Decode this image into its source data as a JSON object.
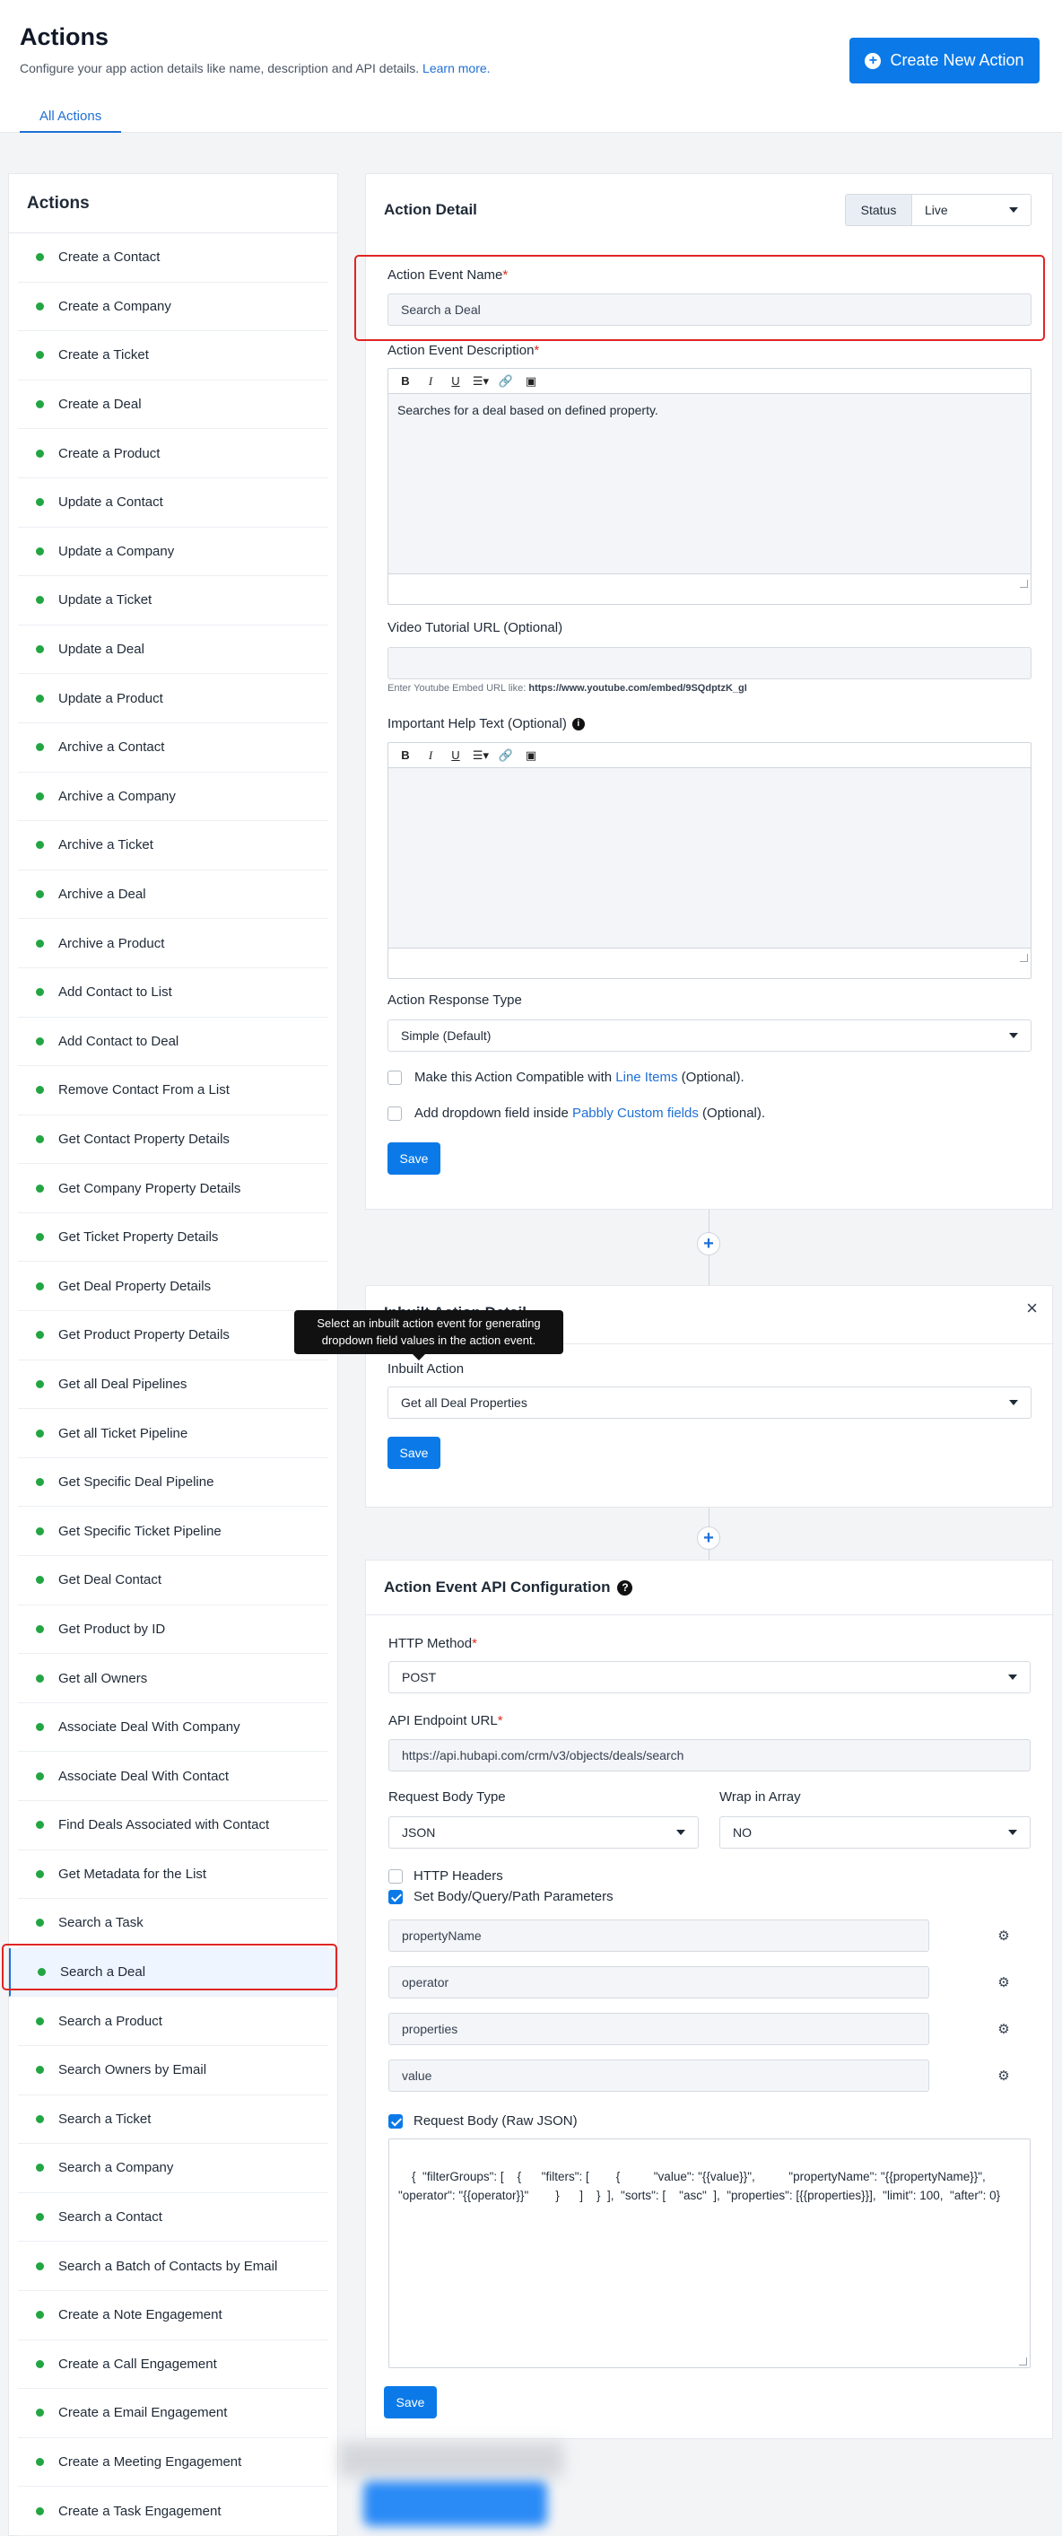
{
  "header": {
    "title": "Actions",
    "subtitle": "Configure your app action details like name, description and API details.",
    "learn_more": "Learn more.",
    "create_button": "Create New Action",
    "tab_all": "All Actions"
  },
  "sidebar": {
    "title": "Actions",
    "items": [
      "Create a Contact",
      "Create a Company",
      "Create a Ticket",
      "Create a Deal",
      "Create a Product",
      "Update a Contact",
      "Update a Company",
      "Update a Ticket",
      "Update a Deal",
      "Update a Product",
      "Archive a Contact",
      "Archive a Company",
      "Archive a Ticket",
      "Archive a Deal",
      "Archive a Product",
      "Add Contact to List",
      "Add Contact to Deal",
      "Remove Contact From a List",
      "Get Contact Property Details",
      "Get Company Property Details",
      "Get Ticket Property Details",
      "Get Deal Property Details",
      "Get Product Property Details",
      "Get all Deal Pipelines",
      "Get all Ticket Pipeline",
      "Get Specific Deal Pipeline",
      "Get Specific Ticket Pipeline",
      "Get Deal Contact",
      "Get Product by ID",
      "Get all Owners",
      "Associate Deal With Company",
      "Associate Deal With Contact",
      "Find Deals Associated with Contact",
      "Get Metadata for the List",
      "Search a Task",
      "Search a Deal",
      "Search a Product",
      "Search Owners by Email",
      "Search a Ticket",
      "Search a Company",
      "Search a Contact",
      "Search a Batch of Contacts by Email",
      "Create a Note Engagement",
      "Create a Call Engagement",
      "Create a Email Engagement",
      "Create a Meeting Engagement",
      "Create a Task Engagement"
    ],
    "active_index": 35
  },
  "action_detail": {
    "title": "Action Detail",
    "status_label": "Status",
    "status_value": "Live",
    "name_label": "Action Event Name",
    "required_mark": "*",
    "name_value": "Search a Deal",
    "desc_label": "Action Event Description",
    "desc_value": "Searches for a deal based on defined property.",
    "video_label": "Video Tutorial URL (Optional)",
    "video_hint_prefix": "Enter Youtube Embed URL like: ",
    "video_hint_url": "https://www.youtube.com/embed/9SQdptzK_gI",
    "help_label": "Important Help Text (Optional)",
    "info_icon_glyph": "i",
    "response_label": "Action Response Type",
    "response_value": "Simple (Default)",
    "compat_prefix": "Make this Action Compatible with ",
    "compat_link": "Line Items",
    "compat_suffix": " (Optional).",
    "dropdown_prefix": "Add dropdown field inside ",
    "dropdown_link": "Pabbly Custom fields",
    "dropdown_suffix": " (Optional).",
    "save": "Save"
  },
  "inbuilt": {
    "tooltip": "Select an inbuilt action event for generating dropdown field values in the action event.",
    "title": "Inbuilt Action Detail",
    "close_glyph": "×",
    "label": "Inbuilt Action",
    "value": "Get all Deal Properties",
    "save": "Save"
  },
  "api": {
    "title": "Action Event API Configuration",
    "help_glyph": "?",
    "method_label": "HTTP Method",
    "method_value": "POST",
    "endpoint_label": "API Endpoint URL",
    "endpoint_value": "https://api.hubapi.com/crm/v3/objects/deals/search",
    "body_type_label": "Request Body Type",
    "body_type_value": "JSON",
    "wrap_label": "Wrap in Array",
    "wrap_value": "NO",
    "headers_label": "HTTP Headers",
    "params_label": "Set Body/Query/Path Parameters",
    "params": [
      "propertyName",
      "operator",
      "properties",
      "value"
    ],
    "raw_label": "Request Body (Raw JSON)",
    "raw_value": "{  \"filterGroups\": [    {      \"filters\": [        {          \"value\": \"{{value}}\",          \"propertyName\": \"{{propertyName}}\",          \"operator\": \"{{operator}}\"        }      ]    }  ],  \"sorts\": [    \"asc\"  ],  \"properties\": [{{properties}}],  \"limit\": 100,  \"after\": 0}",
    "save": "Save"
  },
  "connector_glyph": "+"
}
